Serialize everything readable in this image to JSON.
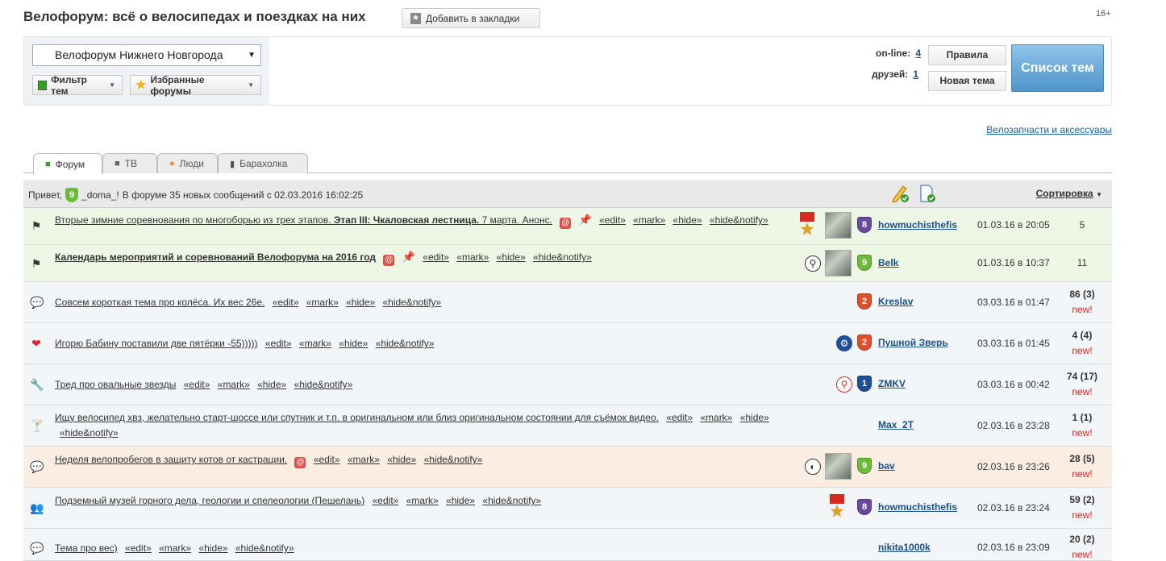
{
  "header": {
    "title": "Велофорум: всё о велосипедах и поездках на них",
    "bookmark_label": "Добавить в закладки",
    "age_rating": "16+"
  },
  "panel": {
    "forum_select": "Велофорум Нижнего Новгорода",
    "filter_label": "Фильтр тем",
    "favorites_label": "Избранные форумы",
    "online_label": "on-line:",
    "online_count": "4",
    "friends_label": "друзей:",
    "friends_count": "1",
    "rules_label": "Правила",
    "new_topic_label": "Новая тема",
    "topics_list_label": "Список тем"
  },
  "spares_link": "Велозапчасти и аксессуары",
  "tabs": [
    {
      "label": "Форум",
      "icon": "chat-icon"
    },
    {
      "label": "ТВ",
      "icon": "camera-icon"
    },
    {
      "label": "Люди",
      "icon": "person-icon"
    },
    {
      "label": "Барахолка",
      "icon": "document-icon"
    }
  ],
  "greeting": {
    "hello": "Привет,",
    "badge": "9",
    "username": "_doma_!",
    "message": "В форуме 35 новых сообщений с 02.03.2016 16:02:25",
    "sort_label": "Сортировка"
  },
  "actions": {
    "edit": "«edit»",
    "mark": "«mark»",
    "hide": "«hide»",
    "hide_notify": "«hide&notify»"
  },
  "topics": [
    {
      "icon": "checkered-flag-icon",
      "title_plain": "Вторые зимние соревнования по многоборью из трех этапов.",
      "title_bold": "Этап III: Чкаловская лестница.",
      "title_tail": "7 марта. Анонс.",
      "author": "howmuchisthefis",
      "level": "8",
      "date": "01.03.16 в 20:05",
      "replies": "5",
      "new": ""
    },
    {
      "icon": "checkered-flag-icon",
      "title_bold": "Календарь мероприятий и соревнований Велофорума на 2016 год",
      "author": "Belk",
      "level": "9",
      "date": "01.03.16 в 10:37",
      "replies": "11",
      "new": ""
    },
    {
      "icon": "speech-bubble-icon",
      "title_plain": "Совсем короткая тема про колёса. Их вес 26e.",
      "author": "Kreslav",
      "level": "2",
      "date": "03.03.16 в 01:47",
      "replies": "86 (3)",
      "new": "new!"
    },
    {
      "icon": "hearts-icon",
      "title_plain": "Игорю Бабину поставили две пятёрки -55)))))",
      "author": "Пушной Зверь",
      "level": "2",
      "date": "03.03.16 в 01:45",
      "replies": "4 (4)",
      "new": "new!"
    },
    {
      "icon": "wrench-icon",
      "title_plain": "Тред про овальные звезды",
      "author": "ZMKV",
      "level": "1",
      "date": "03.03.16 в 00:42",
      "replies": "74 (17)",
      "new": "new!"
    },
    {
      "icon": "cocktail-icon",
      "title_plain": "Ищу велосипед хвз, желательно старт-шоссе или спутник и т.п. в оригинальном или близ оригинальном состоянии для съёмок видео.",
      "author": "Max_2T",
      "date": "02.03.16 в 23:28",
      "replies": "1 (1)",
      "new": "new!"
    },
    {
      "icon": "speech-bubble-icon",
      "title_plain": "Неделя велопробегов в защиту котов от кастрации.",
      "author": "bav",
      "level": "9",
      "date": "02.03.16 в 23:26",
      "replies": "28 (5)",
      "new": "new!"
    },
    {
      "icon": "people-icon",
      "title_plain": "Подземный музей горного дела, геологии и спелеологии (Пешелань)",
      "author": "howmuchisthefis",
      "level": "8",
      "date": "02.03.16 в 23:24",
      "replies": "59 (2)",
      "new": "new!"
    },
    {
      "icon": "speech-bubble-icon",
      "title_plain": "Тема про вес)",
      "author": "nikita1000k",
      "date": "02.03.16 в 23:09",
      "replies": "20 (2)",
      "new": "new!"
    }
  ]
}
